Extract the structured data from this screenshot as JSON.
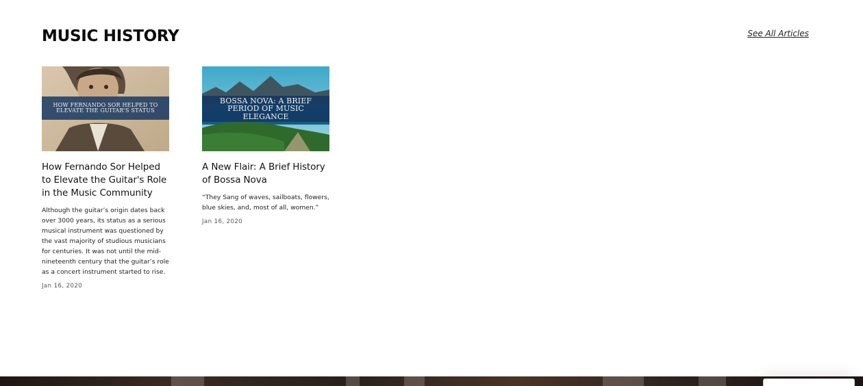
{
  "section": {
    "title": "MUSIC HISTORY",
    "see_all_label": "See All Articles"
  },
  "articles": [
    {
      "image_banner": "HOW FERNANDO SOR HELPED TO ELEVATE THE GUITAR'S STATUS",
      "title": "How Fernando Sor Helped to Elevate the Guitar's Role in the Music Community",
      "excerpt": "Although the guitar’s origin dates back over 3000 years, its status as a serious musical instrument was questioned by the vast majority of studious musicians for centuries. It was not until the mid-nineteenth century that the guitar’s role as a concert instrument started to rise.",
      "date": "Jan 16, 2020"
    },
    {
      "image_banner": "BOSSA NOVA: A BRIEF PERIOD OF MUSIC ELEGANCE",
      "title": "A New Flair: A Brief History of Bossa Nova",
      "excerpt": "“They Sang of waves, sailboats, flowers, blue skies, and, most of all, women.”",
      "date": "Jan 16, 2020"
    }
  ],
  "colors": {
    "banner_overlay": "#123460",
    "footer": "#2a201c"
  }
}
